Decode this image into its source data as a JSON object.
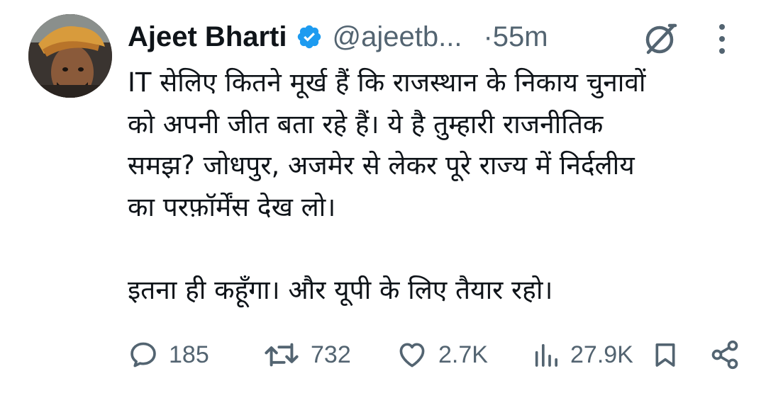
{
  "tweet": {
    "author": {
      "display_name": "Ajeet Bharti",
      "handle": "@ajeetb...",
      "verified": true
    },
    "timestamp": "55m",
    "timestamp_separator": "·",
    "text_lines": [
      "IT सेलिए कितने मूर्ख हैं कि राजस्थान के निकाय चुनावों",
      "को अपनी जीत बता रहे हैं। ये है तुम्हारी राजनीतिक",
      "समझ? जोधपुर, अजमेर से लेकर पूरे राज्य में निर्दलीय",
      "का परफ़ॉर्मेंस देख लो।"
    ],
    "text_paragraph_2": "इतना ही कहूँगा। और यूपी के लिए तैयार रहो।",
    "stats": {
      "replies": "185",
      "retweets": "732",
      "likes": "2.7K",
      "views": "27.9K"
    }
  },
  "icons": {
    "verified": "verified-badge-icon",
    "grok": "grok-icon",
    "more": "more-vertical-icon",
    "reply": "reply-icon",
    "retweet": "retweet-icon",
    "like": "heart-icon",
    "views": "views-bar-chart-icon",
    "bookmark": "bookmark-icon",
    "share": "share-icon"
  },
  "colors": {
    "text_primary": "#0f1419",
    "text_secondary": "#536471",
    "verified_blue": "#1d9bf0",
    "background": "#ffffff"
  }
}
